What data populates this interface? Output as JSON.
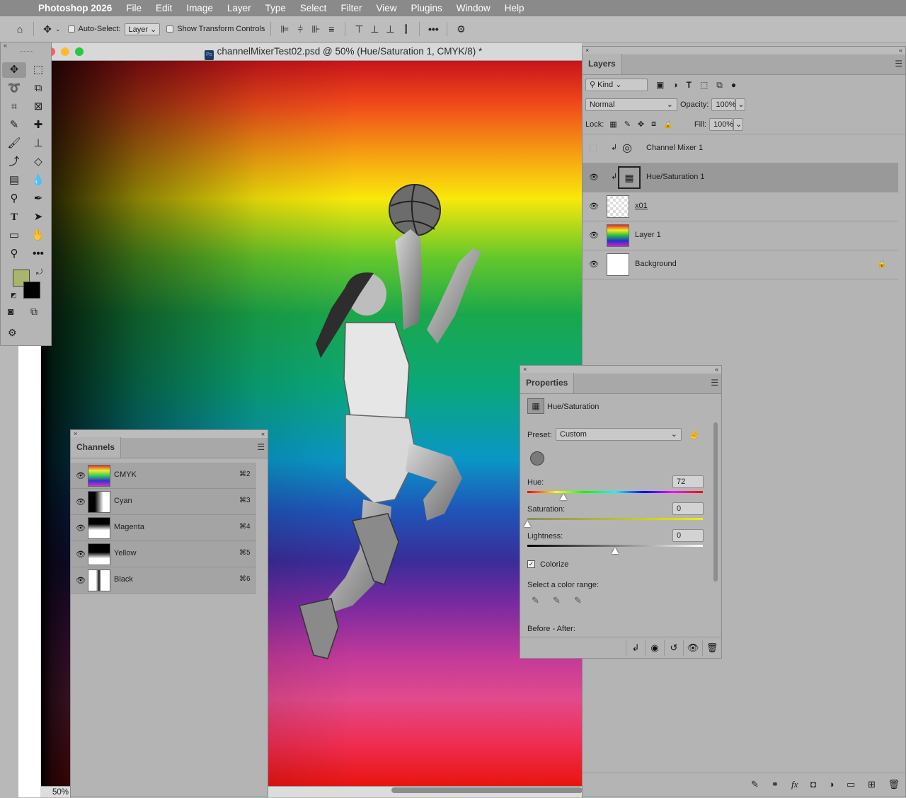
{
  "menubar": {
    "app": "Photoshop 2026",
    "items": [
      "File",
      "Edit",
      "Image",
      "Layer",
      "Type",
      "Select",
      "Filter",
      "View",
      "Plugins",
      "Window",
      "Help"
    ]
  },
  "options": {
    "auto_select_label": "Auto-Select:",
    "auto_select_value": "Layer",
    "show_transform_label": "Show Transform Controls"
  },
  "document": {
    "title": "channelMixerTest02.psd @ 50% (Hue/Saturation 1, CMYK/8) *",
    "zoom": "50%"
  },
  "toolbox": {
    "fg_color": "#a9b56a",
    "bg_color": "#000000"
  },
  "layers": {
    "tab": "Layers",
    "kind_label": "Kind",
    "blend_mode": "Normal",
    "opacity_label": "Opacity:",
    "opacity": "100%",
    "lock_label": "Lock:",
    "fill_label": "Fill:",
    "fill": "100%",
    "items": [
      {
        "name": "Channel Mixer 1",
        "visible": false,
        "selected": false
      },
      {
        "name": "Hue/Saturation 1",
        "visible": true,
        "selected": true
      },
      {
        "name": "x01",
        "visible": true,
        "selected": false
      },
      {
        "name": "Layer 1",
        "visible": true,
        "selected": false
      },
      {
        "name": "Background",
        "visible": true,
        "selected": false
      }
    ]
  },
  "channels": {
    "tab": "Channels",
    "items": [
      {
        "name": "CMYK",
        "shortcut": "⌘2"
      },
      {
        "name": "Cyan",
        "shortcut": "⌘3"
      },
      {
        "name": "Magenta",
        "shortcut": "⌘4"
      },
      {
        "name": "Yellow",
        "shortcut": "⌘5"
      },
      {
        "name": "Black",
        "shortcut": "⌘6"
      }
    ]
  },
  "properties": {
    "tab": "Properties",
    "adjustment": "Hue/Saturation",
    "preset_label": "Preset:",
    "preset": "Custom",
    "hue_label": "Hue:",
    "hue": "72",
    "saturation_label": "Saturation:",
    "saturation": "0",
    "lightness_label": "Lightness:",
    "lightness": "0",
    "colorize_label": "Colorize",
    "colorize_checked": true,
    "color_range_label": "Select a color range:",
    "before_after_label": "Before - After:"
  }
}
